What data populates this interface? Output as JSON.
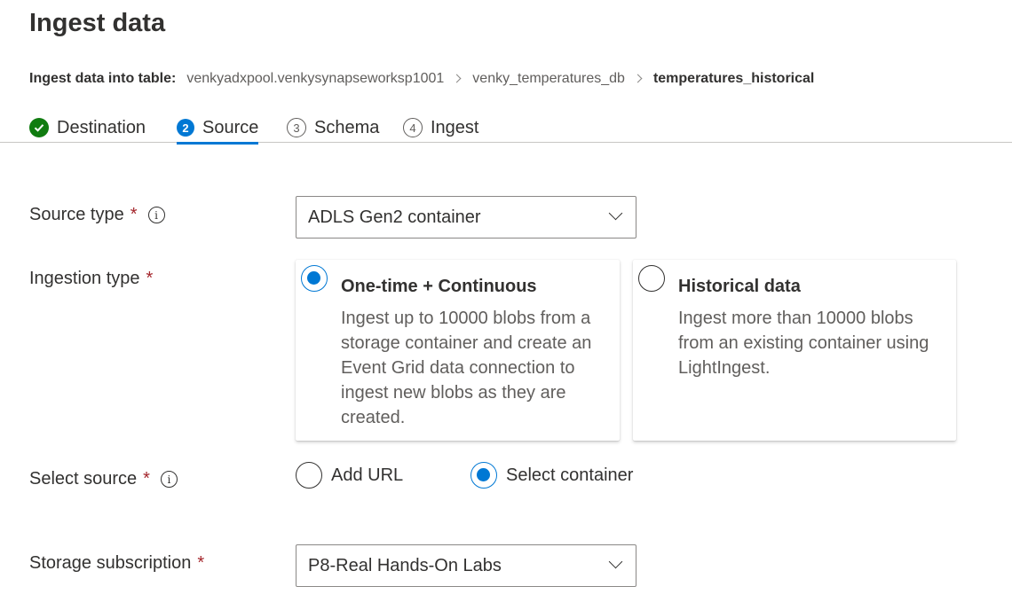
{
  "page": {
    "title": "Ingest data"
  },
  "breadcrumb": {
    "label": "Ingest data into table:",
    "crumbs": [
      "venkyadxpool.venkysynapseworksp1001",
      "venky_temperatures_db"
    ],
    "current": "temperatures_historical"
  },
  "tabs": [
    {
      "label": "Destination",
      "state": "done",
      "icon": "check-icon"
    },
    {
      "label": "Source",
      "state": "active",
      "number": "2"
    },
    {
      "label": "Schema",
      "state": "pending",
      "number": "3"
    },
    {
      "label": "Ingest",
      "state": "pending",
      "number": "4"
    }
  ],
  "form": {
    "required_marker": "*",
    "info_glyph": "i",
    "source_type": {
      "label": "Source type",
      "value": "ADLS Gen2 container"
    },
    "ingestion_type": {
      "label": "Ingestion type",
      "options": [
        {
          "title": "One-time + Continuous",
          "description": "Ingest up to 10000 blobs from a storage container and create an Event Grid data connection to ingest new blobs as they are created.",
          "selected": true
        },
        {
          "title": "Historical data",
          "description": "Ingest more than 10000 blobs from an existing container using LightIngest.",
          "selected": false
        }
      ]
    },
    "select_source": {
      "label": "Select source",
      "options": [
        {
          "label": "Add URL",
          "selected": false
        },
        {
          "label": "Select container",
          "selected": true
        }
      ]
    },
    "storage_subscription": {
      "label": "Storage subscription",
      "value": "P8-Real Hands-On Labs"
    }
  },
  "colors": {
    "accent": "#0078d4",
    "success": "#107c10",
    "required": "#a4262c",
    "text": "#323130"
  }
}
